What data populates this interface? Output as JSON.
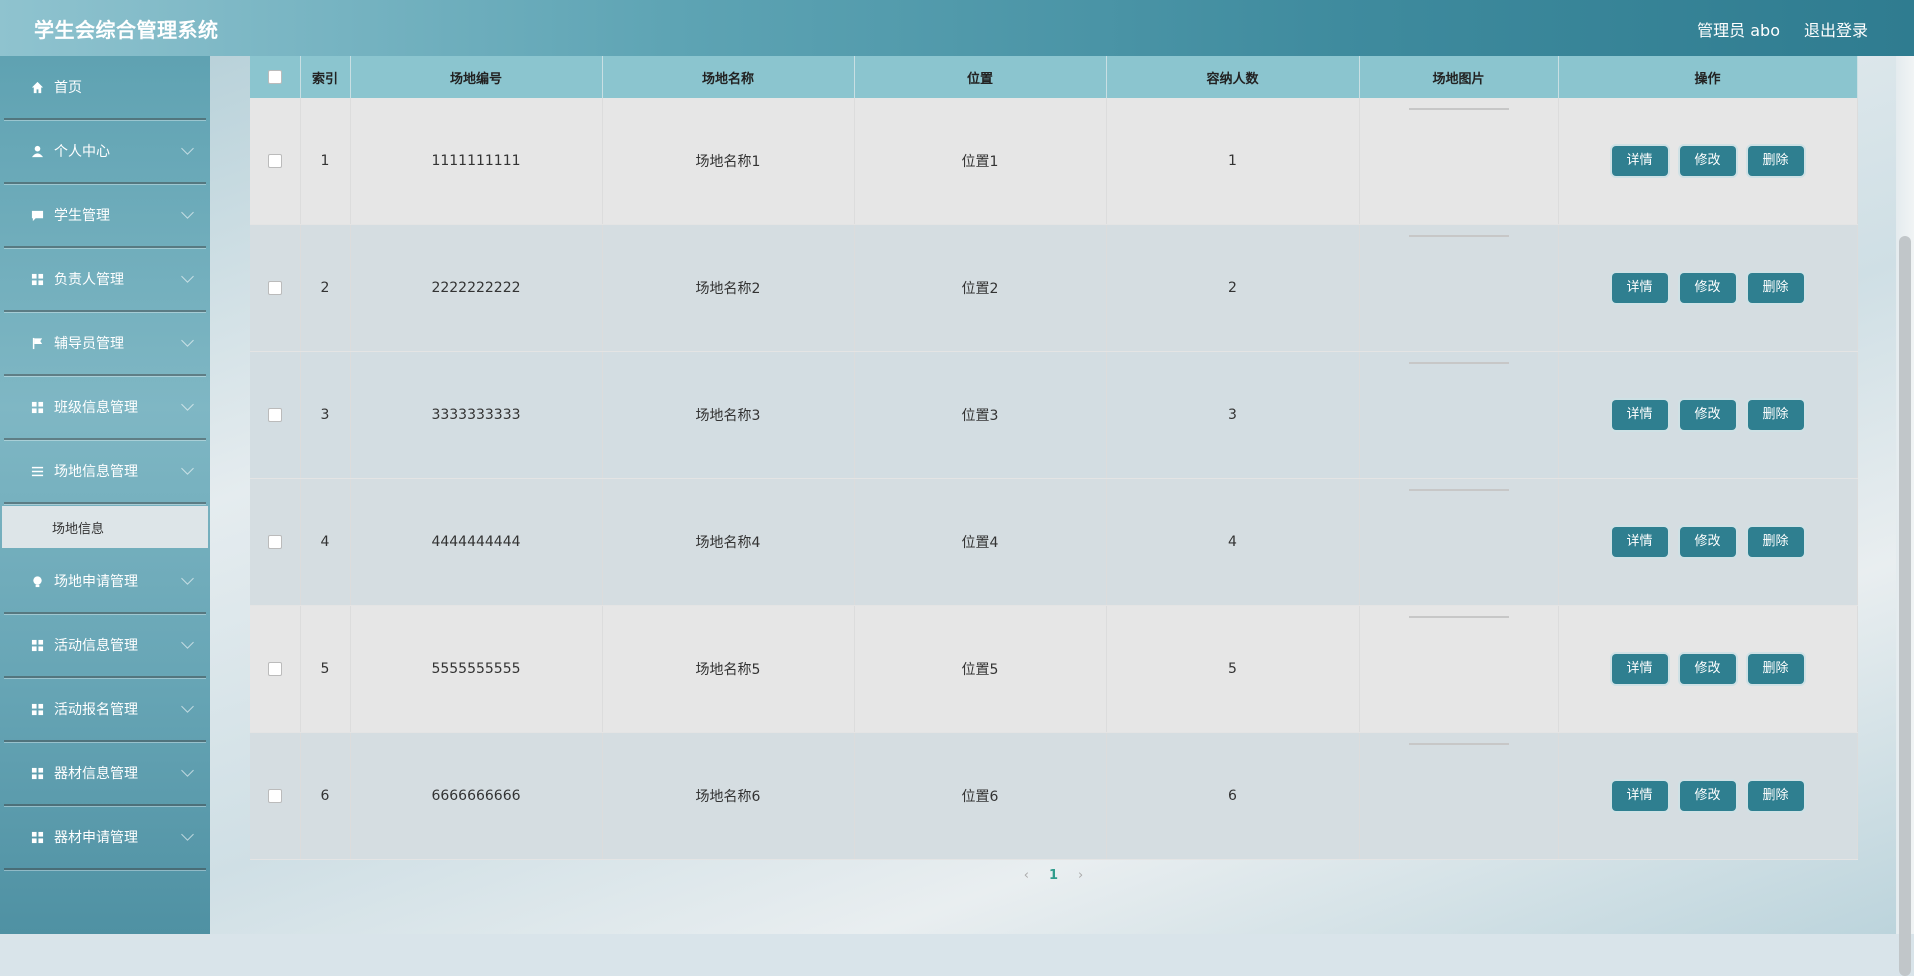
{
  "header": {
    "title": "学生会综合管理系统",
    "user": "管理员 abo",
    "logout": "退出登录"
  },
  "sidebar": {
    "items": [
      {
        "label": "首页",
        "icon": "home-icon"
      },
      {
        "label": "个人中心",
        "icon": "user-icon"
      },
      {
        "label": "学生管理",
        "icon": "chat-icon"
      },
      {
        "label": "负责人管理",
        "icon": "grid-icon"
      },
      {
        "label": "辅导员管理",
        "icon": "flag-icon"
      },
      {
        "label": "班级信息管理",
        "icon": "grid-icon"
      },
      {
        "label": "场地信息管理",
        "icon": "list-icon"
      },
      {
        "label": "场地申请管理",
        "icon": "bulb-icon"
      },
      {
        "label": "活动信息管理",
        "icon": "grid-icon"
      },
      {
        "label": "活动报名管理",
        "icon": "grid-icon"
      },
      {
        "label": "器材信息管理",
        "icon": "grid-icon"
      },
      {
        "label": "器材申请管理",
        "icon": "grid-icon"
      }
    ],
    "active_sub": "场地信息"
  },
  "table": {
    "headers": [
      "索引",
      "场地编号",
      "场地名称",
      "位置",
      "容纳人数",
      "场地图片",
      "操作"
    ],
    "rows": [
      {
        "index": "1",
        "code": "1111111111",
        "name": "场地名称1",
        "location": "位置1",
        "capacity": "1"
      },
      {
        "index": "2",
        "code": "2222222222",
        "name": "场地名称2",
        "location": "位置2",
        "capacity": "2"
      },
      {
        "index": "3",
        "code": "3333333333",
        "name": "场地名称3",
        "location": "位置3",
        "capacity": "3"
      },
      {
        "index": "4",
        "code": "4444444444",
        "name": "场地名称4",
        "location": "位置4",
        "capacity": "4"
      },
      {
        "index": "5",
        "code": "5555555555",
        "name": "场地名称5",
        "location": "位置5",
        "capacity": "5"
      },
      {
        "index": "6",
        "code": "6666666666",
        "name": "场地名称6",
        "location": "位置6",
        "capacity": "6"
      }
    ],
    "actions": {
      "detail": "详情",
      "edit": "修改",
      "delete": "删除"
    }
  },
  "pager": {
    "prev": "‹",
    "current": "1",
    "next": "›"
  }
}
